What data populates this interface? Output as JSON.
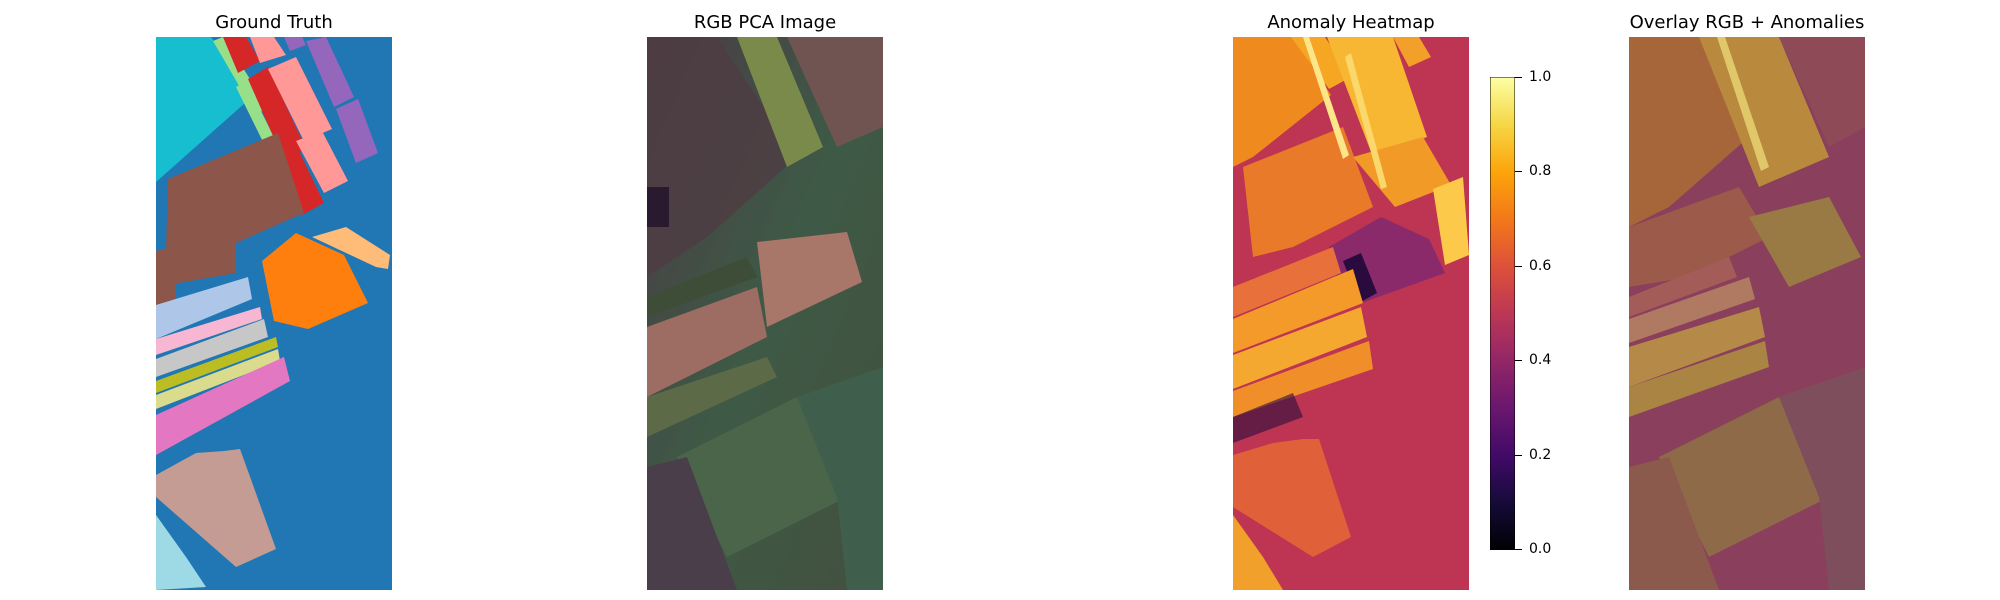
{
  "panels": [
    {
      "title": "Ground Truth"
    },
    {
      "title": "RGB PCA Image"
    },
    {
      "title": "Anomaly Heatmap"
    },
    {
      "title": "Overlay RGB + Anomalies"
    }
  ],
  "colorbar": {
    "colormap": "inferno",
    "range": [
      0.0,
      1.0
    ],
    "ticks": [
      "0.0",
      "0.2",
      "0.4",
      "0.6",
      "0.8",
      "1.0"
    ]
  },
  "colors": {
    "ground_truth_background": "#2077b4",
    "heatmap_background": "#bd3552",
    "overlay_background": "#8a3f5c"
  }
}
